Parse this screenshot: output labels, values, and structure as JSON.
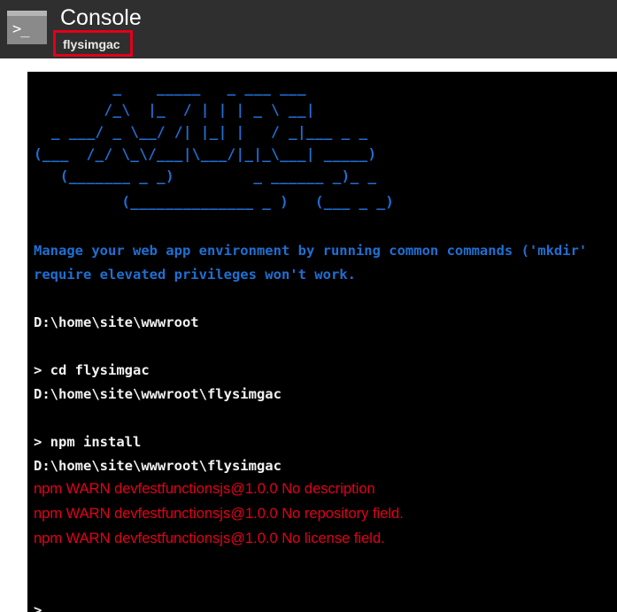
{
  "header": {
    "icon": "console-icon",
    "icon_glyph": ">_",
    "title": "Console",
    "subtitle": "flysimgac",
    "highlight_color": "#e3001b"
  },
  "terminal": {
    "ascii_art": [
      "         _    _____   _ ___ ___",
      "        /_\\  |_  / | | | _ \\ __|",
      "  _ ___/ _ \\__/ /| |_| |   / _|___ _ _",
      "(___  /_/ \\_\\/___|\\___/|_|_\\___| _____)",
      "   (_______ _ _)         _ ______ _)_ _",
      "          (______________ _ )   (___ _ _)"
    ],
    "intro_lines": [
      "Manage your web app environment by running common commands ('mkdir'",
      "require elevated privileges won't work."
    ],
    "initial_path": "D:\\home\\site\\wwwroot",
    "cmd1": "> cd flysimgac",
    "path1": "D:\\home\\site\\wwwroot\\flysimgac",
    "cmd2": "> npm install",
    "path2": "D:\\home\\site\\wwwroot\\flysimgac",
    "warnings": [
      "npm WARN devfestfunctionsjs@1.0.0 No description",
      "npm WARN devfestfunctionsjs@1.0.0 No repository field.",
      "npm WARN devfestfunctionsjs@1.0.0 No license field."
    ],
    "prompt": ">"
  }
}
